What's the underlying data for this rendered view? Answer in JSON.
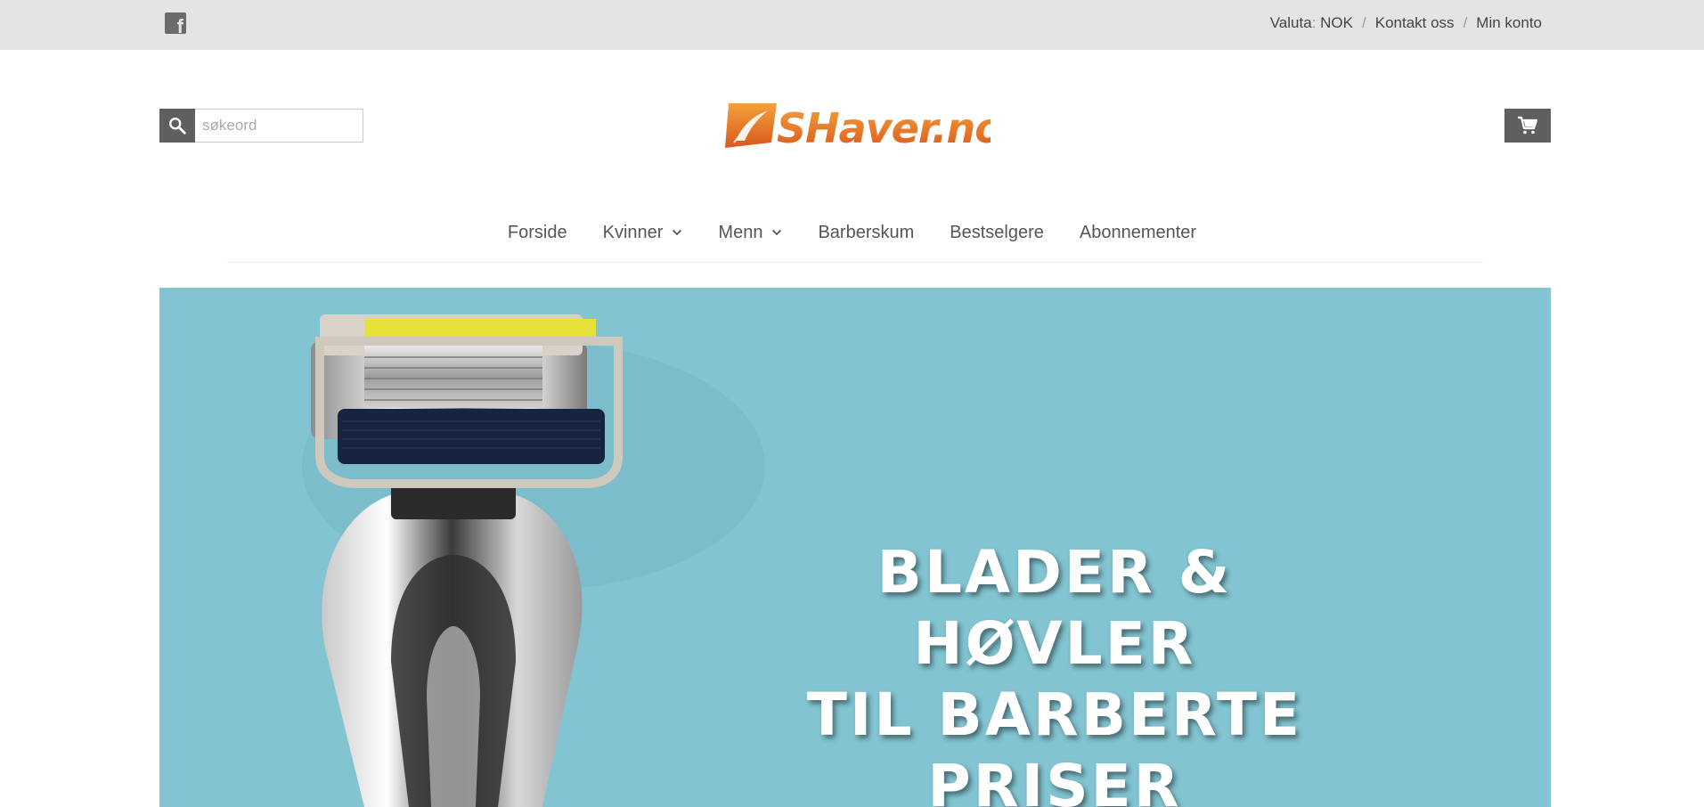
{
  "topbar": {
    "social_icon": "facebook-icon",
    "currency_label": "Valuta",
    "currency_colon": ":",
    "currency_value": "NOK",
    "separator": "/",
    "contact_label": "Kontakt oss",
    "account_label": "Min konto"
  },
  "header": {
    "search_placeholder": "søkeord",
    "search_icon": "search-icon",
    "logo_text": "SHaver.no",
    "cart_icon": "cart-icon"
  },
  "nav": {
    "items": [
      {
        "label": "Forside",
        "dropdown": false
      },
      {
        "label": "Kvinner",
        "dropdown": true
      },
      {
        "label": "Menn",
        "dropdown": true
      },
      {
        "label": "Barberskum",
        "dropdown": false
      },
      {
        "label": "Bestselgere",
        "dropdown": false
      },
      {
        "label": "Abonnementer",
        "dropdown": false
      }
    ]
  },
  "hero": {
    "lines": [
      "BLADER & HØVLER",
      "TIL BARBERTE",
      "PRISER"
    ],
    "background_color": "#82c4d1"
  },
  "colors": {
    "topbar_bg": "#e4e4e6",
    "button_bg": "#5f5f5f",
    "logo_orange": "#e8752a"
  }
}
